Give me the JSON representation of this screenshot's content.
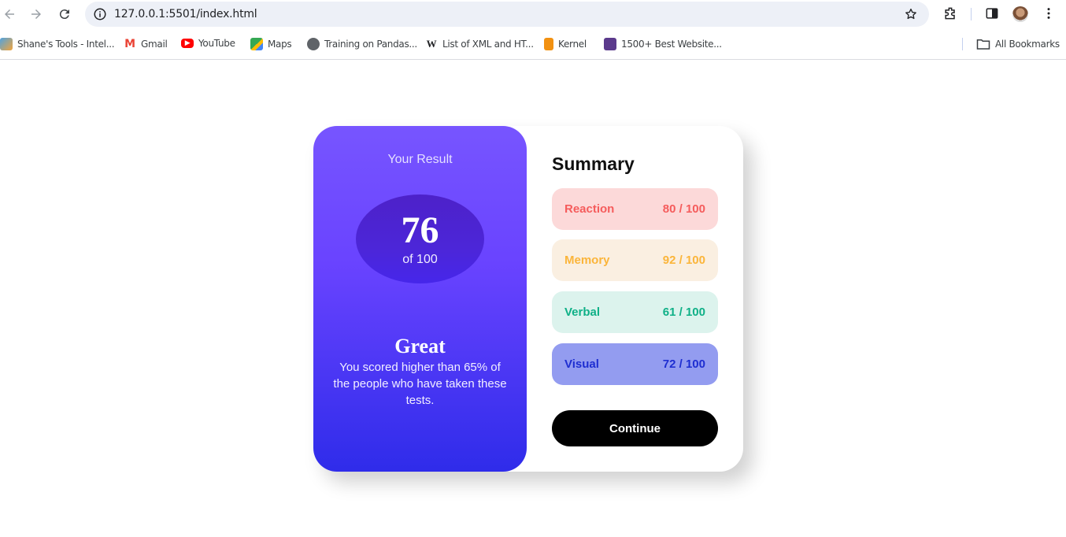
{
  "browser": {
    "url": "127.0.0.1:5501/index.html",
    "icons": [
      "back-icon",
      "forward-icon",
      "reload-icon",
      "info-icon",
      "star-icon",
      "extensions-icon",
      "side-panel-icon",
      "profile-avatar",
      "menu-icon"
    ],
    "bookmarks": [
      {
        "label": "Shane's Tools - Intel...",
        "icon": "tools-favicon"
      },
      {
        "label": "Gmail",
        "icon": "gmail-favicon"
      },
      {
        "label": "YouTube",
        "icon": "youtube-favicon"
      },
      {
        "label": "Maps",
        "icon": "maps-favicon"
      },
      {
        "label": "Training on Pandas...",
        "icon": "globe-favicon"
      },
      {
        "label": "List of XML and HT...",
        "icon": "wikipedia-favicon"
      },
      {
        "label": "Kernel",
        "icon": "kernel-favicon"
      },
      {
        "label": "1500+ Best Website...",
        "icon": "site-favicon"
      }
    ],
    "all_bookmarks": "All Bookmarks"
  },
  "result": {
    "title": "Your Result",
    "score": "76",
    "out_of": "of 100",
    "rating": "Great",
    "description": "You scored higher than 65% of the people who have taken these tests."
  },
  "summary": {
    "title": "Summary",
    "items": [
      {
        "label": "Reaction",
        "score": "80 / 100",
        "bg": "#fcd9d9",
        "color": "#f55c5c"
      },
      {
        "label": "Memory",
        "score": "92 / 100",
        "bg": "#faefe1",
        "color": "#fbb53a"
      },
      {
        "label": "Verbal",
        "score": "61 / 100",
        "bg": "#dcf3ed",
        "color": "#0fb087"
      },
      {
        "label": "Visual",
        "score": "72 / 100",
        "bg": "#939cf0",
        "color": "#1e2ed1"
      }
    ],
    "button": "Continue"
  },
  "colors": {
    "gradient_top": "#7755ff",
    "gradient_bottom": "#2f2cea",
    "button": "#000000"
  }
}
